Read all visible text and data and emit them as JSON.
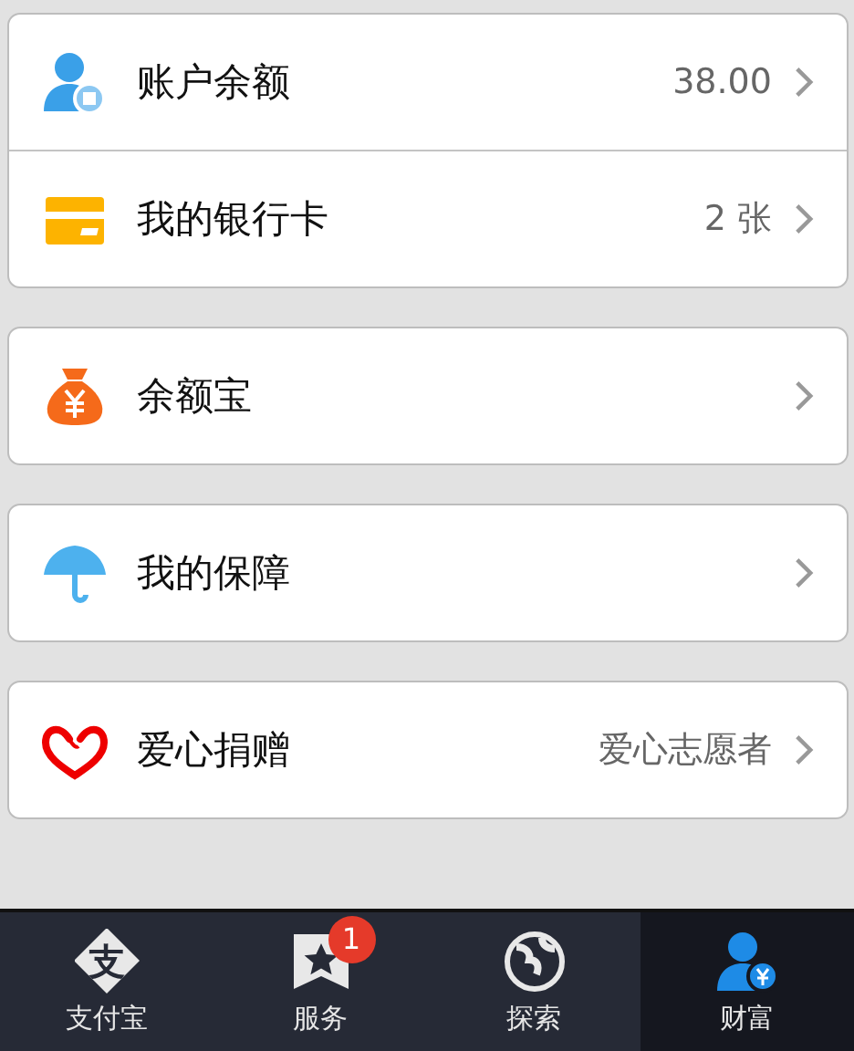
{
  "groups": [
    {
      "rows": [
        {
          "kind": "account",
          "label": "账户余额",
          "value": "38.00"
        },
        {
          "kind": "card",
          "label": "我的银行卡",
          "value": "2 张"
        }
      ]
    },
    {
      "rows": [
        {
          "kind": "moneybag",
          "label": "余额宝"
        }
      ]
    },
    {
      "rows": [
        {
          "kind": "umbrella",
          "label": "我的保障"
        }
      ]
    },
    {
      "rows": [
        {
          "kind": "heart",
          "label": "爱心捐赠",
          "value": "爱心志愿者"
        }
      ]
    }
  ],
  "tab_bar": [
    {
      "kind": "alipay",
      "glyph": "支",
      "label": "支付宝",
      "selected": false
    },
    {
      "kind": "star",
      "label": "服务",
      "badge": "1",
      "selected": false
    },
    {
      "kind": "globe",
      "label": "探索",
      "selected": false
    },
    {
      "kind": "wealth",
      "label": "财富",
      "selected": true
    }
  ]
}
